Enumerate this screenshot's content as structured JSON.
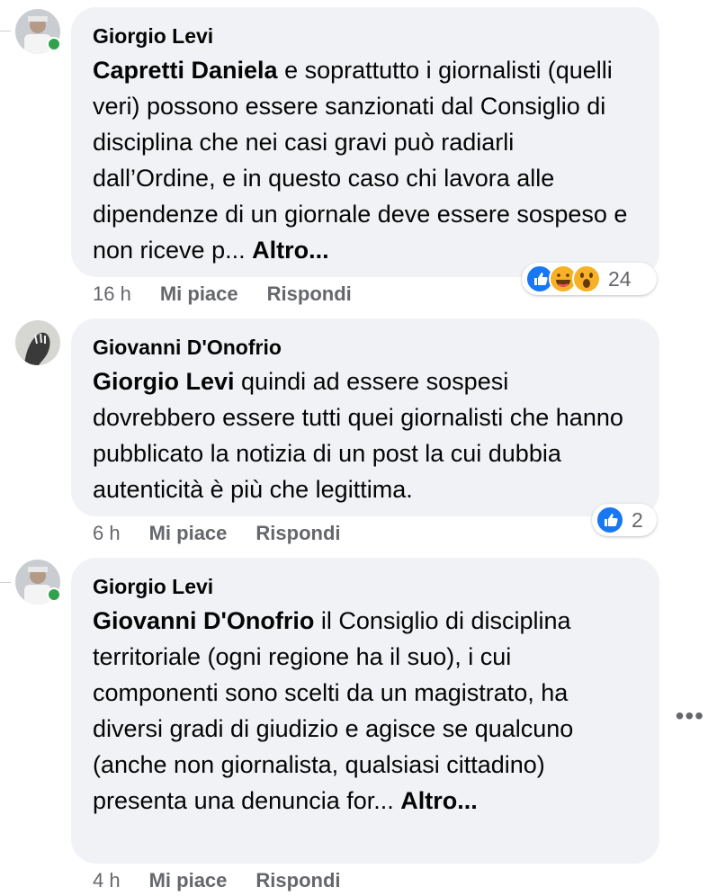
{
  "comments": [
    {
      "author": "Giorgio Levi",
      "mention": "Capretti Daniela",
      "body": " e soprattutto i giornalisti (quelli veri) possono essere sanzionati dal Consiglio di disciplina che nei casi gravi può radiarli dall’Ordine, e in questo caso chi lavora alle dipendenze di un giornale deve essere sospeso e non riceve p... ",
      "more": "Altro...",
      "time": "16 h",
      "like": "Mi piace",
      "reply": "Rispondi",
      "reaction_icons": [
        "like-reaction-icon",
        "haha-reaction-icon",
        "wow-reaction-icon"
      ],
      "reaction_count": "24"
    },
    {
      "author": "Giovanni D'Onofrio",
      "mention": "Giorgio Levi",
      "body": " quindi ad essere sospesi dovrebbero essere tutti quei giornalisti che hanno pubblicato la notizia di un post la cui dubbia autenticità è più che legittima.",
      "more": "",
      "time": "6 h",
      "like": "Mi piace",
      "reply": "Rispondi",
      "reaction_icons": [
        "like-reaction-icon"
      ],
      "reaction_count": "2"
    },
    {
      "author": "Giorgio Levi",
      "mention": "Giovanni D'Onofrio",
      "body": " il Consiglio di disciplina territoriale (ogni regione ha il suo), i cui componenti sono scelti da un magistrato, ha diversi gradi di giudizio e agisce se qualcuno (anche non giornalista, qualsiasi cittadino) presenta una denuncia for... ",
      "more": "Altro...",
      "time": "4 h",
      "like": "Mi piace",
      "reply": "Rispondi"
    }
  ],
  "more_options": "•••",
  "colors": {
    "bubble": "#f0f2f5",
    "meta_text": "#65676b",
    "like_blue": "#1877f2",
    "online_green": "#31a24c"
  }
}
